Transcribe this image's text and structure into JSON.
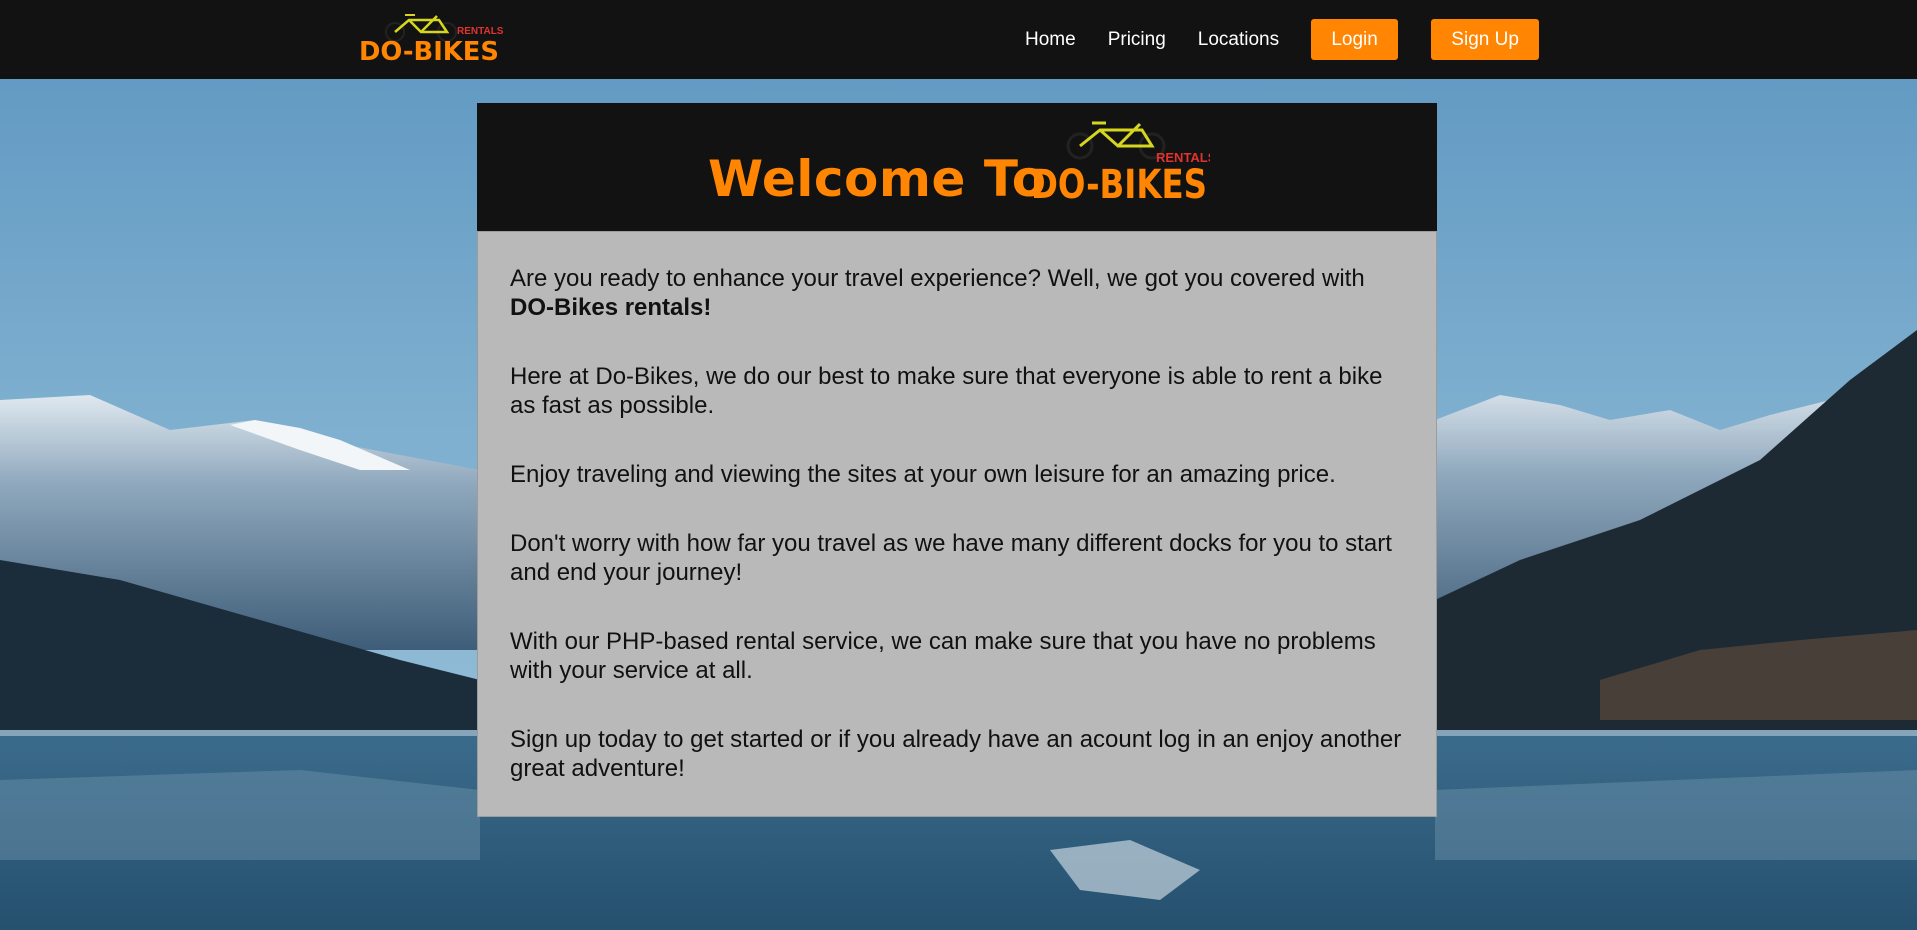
{
  "nav": {
    "logo_main": "DO-BIKES",
    "logo_sub": "RENTALS",
    "links": [
      "Home",
      "Pricing",
      "Locations"
    ],
    "login_label": "Login",
    "signup_label": "Sign Up"
  },
  "hero": {
    "welcome_prefix": "Welcome To",
    "logo_main": "DO-BIKES",
    "logo_sub": "RENTALS"
  },
  "content": {
    "p1_text": "Are you ready to enhance your travel experience? Well, we got you covered with ",
    "p1_bold": "DO-Bikes rentals!",
    "p2": "Here at Do-Bikes, we do our best to make sure that everyone is able to rent a bike as fast as possible.",
    "p3": "Enjoy traveling and viewing the sites at your own leisure for an amazing price.",
    "p4": "Don't worry with how far you travel as we have many different docks for you to start and end your journey!",
    "p5": "With our PHP-based rental service, we can make sure that you have no problems with your service at all.",
    "p6": "Sign up today to get started or if you already have an acount log in an enjoy another great adventure!"
  },
  "colors": {
    "accent": "#ff8503",
    "nav_bg": "#121212",
    "card_bg": "#b9b9b9",
    "logo_sub": "#e0332f",
    "bike_frame": "#d6d61e"
  },
  "icons": {
    "logo": "bicycle-icon"
  }
}
